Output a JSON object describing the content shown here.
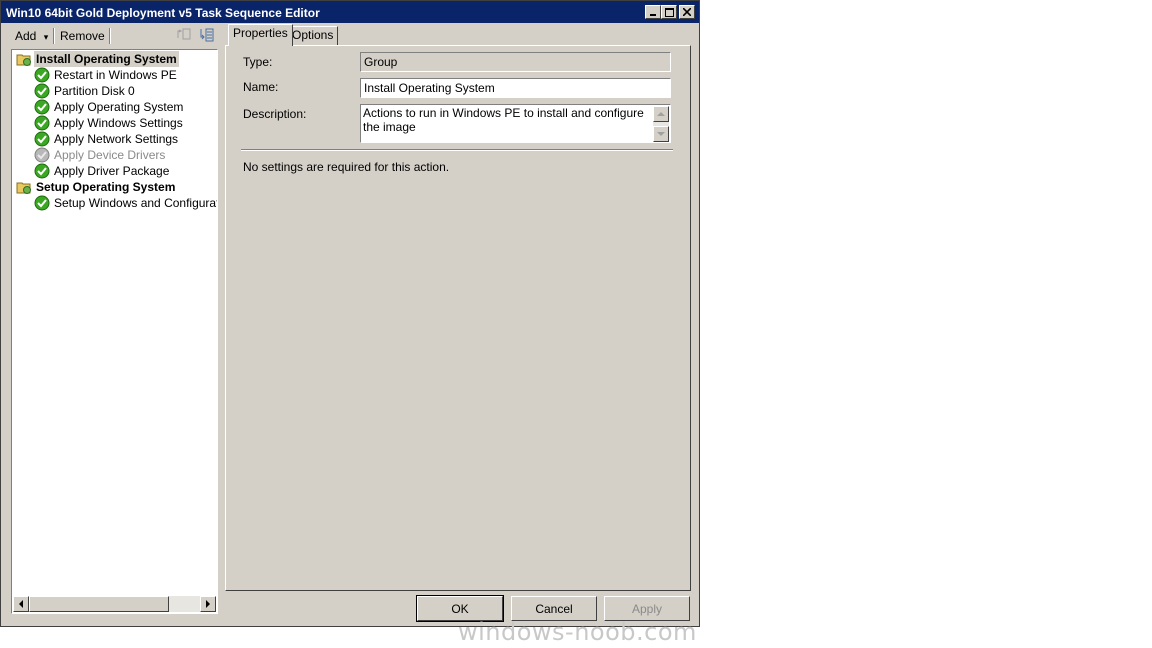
{
  "window": {
    "title": "Win10 64bit Gold Deployment v5 Task Sequence Editor",
    "controls": {
      "minimize": "_",
      "maximize": "□",
      "close": "✕"
    }
  },
  "toolbar": {
    "add_label": "Add",
    "add_arrow": "▾",
    "remove_label": "Remove"
  },
  "tree": {
    "items": [
      {
        "label": "Install Operating System",
        "kind": "group",
        "state": "selected",
        "icon": "folder-icon"
      },
      {
        "label": "Restart in Windows PE",
        "kind": "step",
        "state": "enabled",
        "icon": "check-icon"
      },
      {
        "label": "Partition Disk 0",
        "kind": "step",
        "state": "enabled",
        "icon": "check-icon"
      },
      {
        "label": "Apply Operating System",
        "kind": "step",
        "state": "enabled",
        "icon": "check-icon"
      },
      {
        "label": "Apply Windows Settings",
        "kind": "step",
        "state": "enabled",
        "icon": "check-icon"
      },
      {
        "label": "Apply Network Settings",
        "kind": "step",
        "state": "enabled",
        "icon": "check-icon"
      },
      {
        "label": "Apply Device Drivers",
        "kind": "step",
        "state": "disabled",
        "icon": "check-icon"
      },
      {
        "label": "Apply Driver Package",
        "kind": "step",
        "state": "enabled",
        "icon": "check-icon"
      },
      {
        "label": "Setup Operating System",
        "kind": "group",
        "state": "enabled",
        "icon": "folder-icon"
      },
      {
        "label": "Setup Windows and Configuration",
        "kind": "step",
        "state": "enabled",
        "icon": "check-icon"
      }
    ]
  },
  "tabs": [
    {
      "label": "Properties",
      "active": true
    },
    {
      "label": "Options",
      "active": false
    }
  ],
  "properties": {
    "type_label": "Type:",
    "type_value": "Group",
    "name_label": "Name:",
    "name_value": "Install Operating System",
    "description_label": "Description:",
    "description_value": "Actions to run in Windows PE to install and configure the image",
    "info_text": "No settings are required  for this action."
  },
  "buttons": {
    "ok": "OK",
    "cancel": "Cancel",
    "apply": "Apply"
  },
  "watermark": "windows-noob.com",
  "colors": {
    "titlebar": "#0a246a",
    "face": "#d4d0c8",
    "check_green": "#3aa820",
    "folder_yellow": "#e8c860"
  }
}
